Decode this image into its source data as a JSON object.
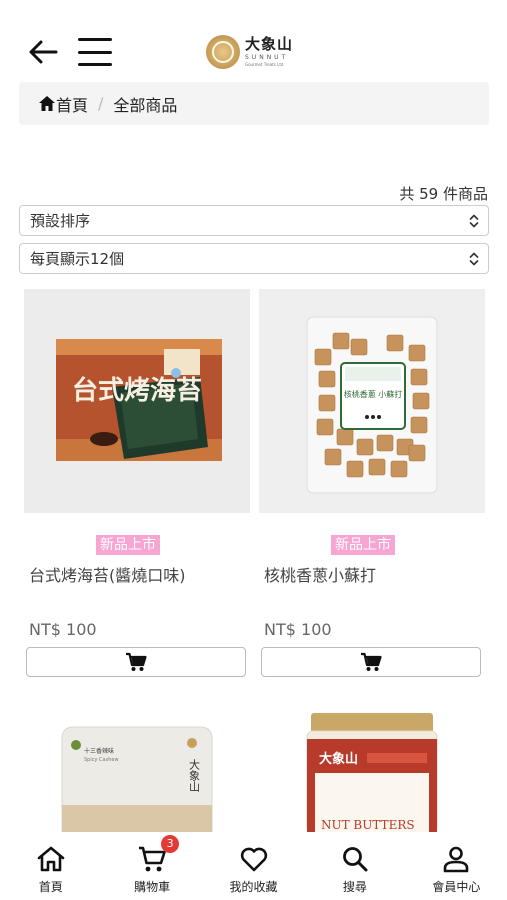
{
  "header": {
    "logo": {
      "cn": "大象山",
      "en": "SUNNUT",
      "sub": "Gourmet Treats Ltd"
    }
  },
  "breadcrumb": {
    "home": "首頁",
    "current": "全部商品"
  },
  "result_count": "共 59 件商品",
  "sort": {
    "selected": "預設排序"
  },
  "per_page": {
    "selected": "每頁顯示12個"
  },
  "products": [
    {
      "badge": "新品上市",
      "name": "台式烤海苔(醬燒口味)",
      "price": "NT$ 100",
      "image": "seaweed-package",
      "package_label": "台式烤海苔"
    },
    {
      "badge": "新品上市",
      "name": "核桃香蔥小蘇打",
      "price": "NT$ 100",
      "image": "walnut-cracker-bag",
      "package_label": "核桃香蔥 小蘇打"
    }
  ],
  "products_row2": [
    {
      "image": "spicy-snack-pouch",
      "package_label": "十三香辣味",
      "package_sub": "Spicy Cashew",
      "brand": "大象山"
    },
    {
      "image": "nut-butter-jar",
      "package_label": "NUT BUTTERS",
      "brand": "大象山"
    }
  ],
  "bottom_nav": [
    {
      "label": "首頁",
      "icon": "home-icon"
    },
    {
      "label": "購物車",
      "icon": "cart-icon",
      "badge": "3"
    },
    {
      "label": "我的收藏",
      "icon": "heart-icon"
    },
    {
      "label": "搜尋",
      "icon": "search-icon"
    },
    {
      "label": "會員中心",
      "icon": "user-icon"
    }
  ],
  "colors": {
    "badge": "#f7a6d4",
    "cart_badge": "#e53935",
    "breadcrumb_bg": "#f4f4f4"
  }
}
